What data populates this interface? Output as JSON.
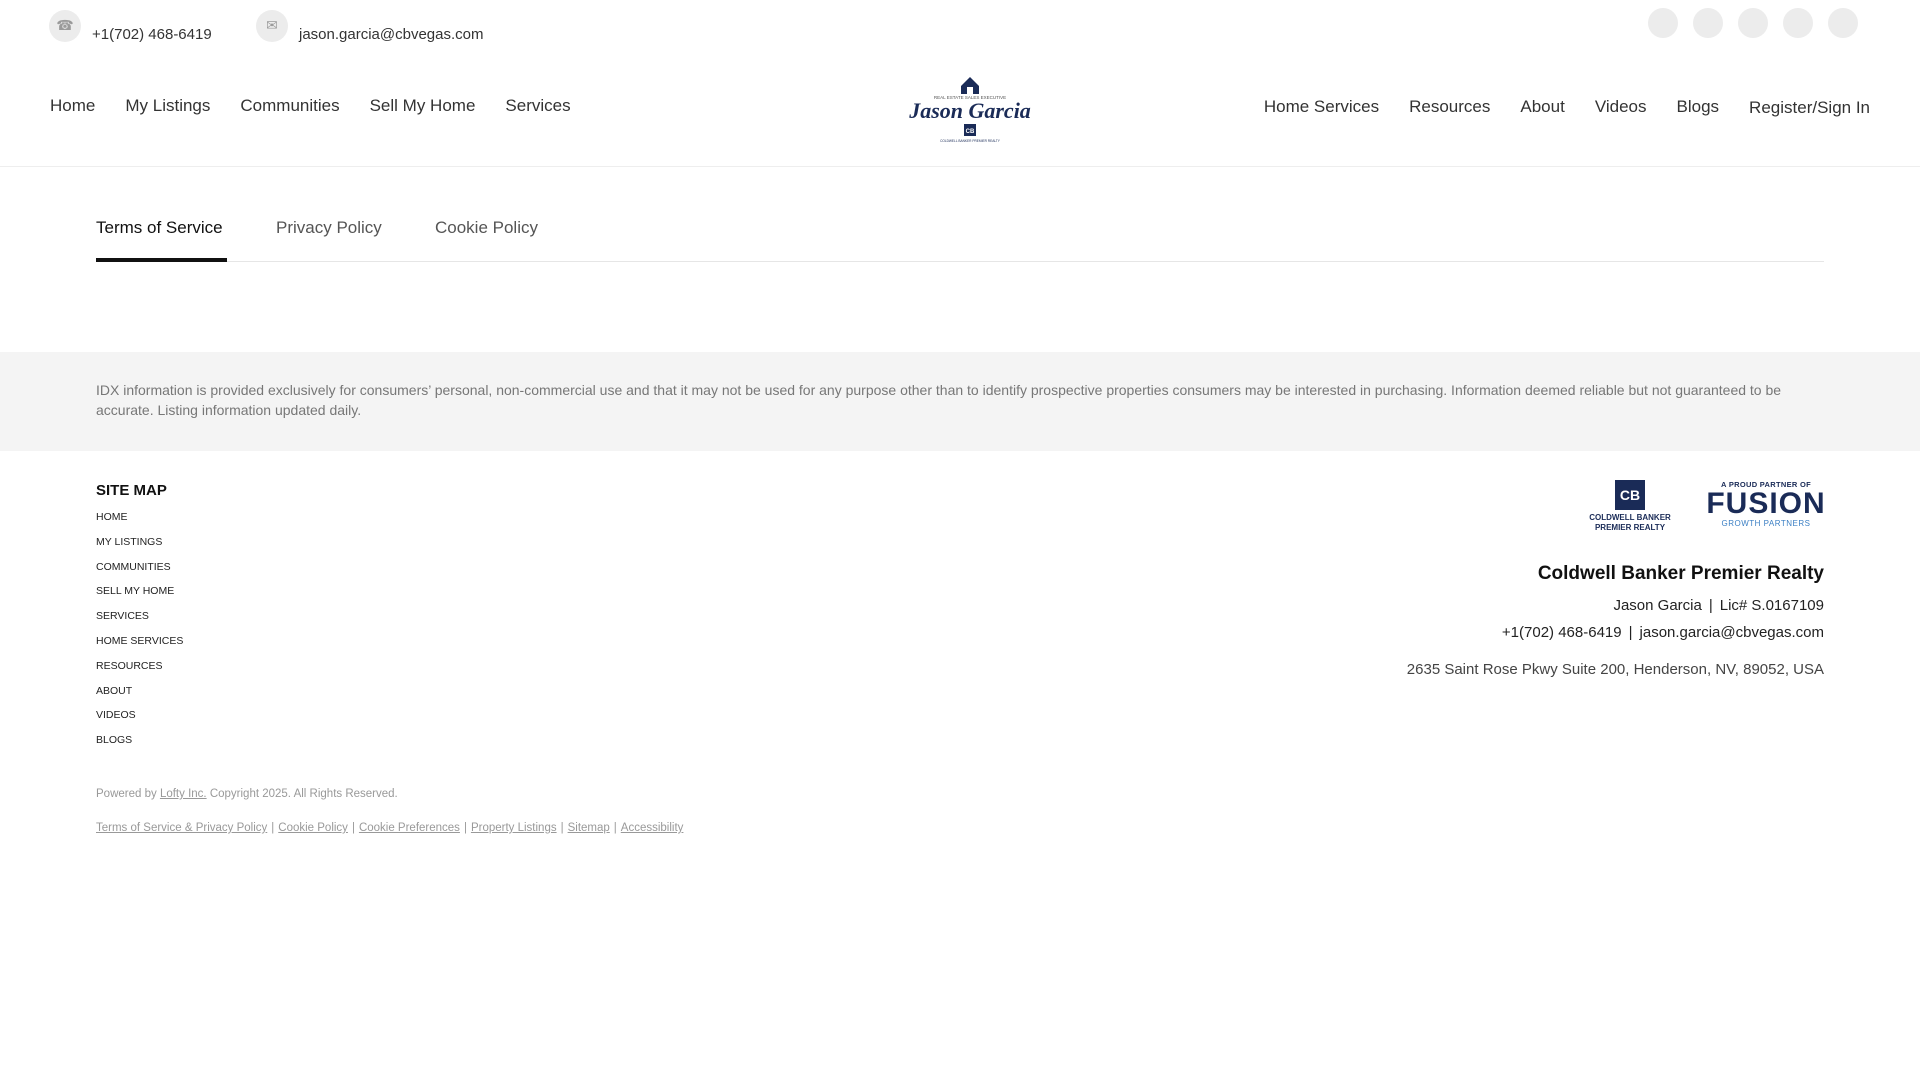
{
  "topbar": {
    "phone": "+1(702) 468-6419",
    "email": "jason.garcia@cbvegas.com",
    "phone_icon": "phone-icon",
    "email_icon": "mail-icon",
    "social_icons": [
      "facebook-icon",
      "instagram-icon",
      "linkedin-icon",
      "youtube-icon",
      "twitter-icon"
    ]
  },
  "nav": {
    "left": [
      "Home",
      "My Listings",
      "Communities",
      "Sell My Home",
      "Services"
    ],
    "right": [
      "Home Services",
      "Resources",
      "About",
      "Videos",
      "Blogs"
    ],
    "signin": "Register/Sign In"
  },
  "logo": {
    "tagline": "REAL ESTATE SALES EXECUTIVE",
    "name": "Jason Garcia",
    "sub": "COLDWELL BANKER PREMIER REALTY"
  },
  "tabs": {
    "items": [
      "Terms of Service",
      "Privacy Policy",
      "Cookie Policy"
    ],
    "active": "Terms of Service"
  },
  "idx_disclaimer": "IDX information is provided exclusively for consumers’ personal, non-commercial use and that it may not be used for any purpose other than to identify prospective properties consumers may be interested in purchasing. Information deemed reliable but not guaranteed to be accurate. Listing information updated daily.",
  "footer": {
    "sitemap_title": "SITE MAP",
    "sitemap": [
      "HOME",
      "MY LISTINGS",
      "COMMUNITIES",
      "SELL MY HOME",
      "SERVICES",
      "HOME SERVICES",
      "RESOURCES",
      "ABOUT",
      "VIDEOS",
      "BLOGS"
    ],
    "cb_logo": {
      "mark": "CB",
      "line1": "COLDWELL BANKER",
      "line2": "PREMIER REALTY"
    },
    "fusion_logo": {
      "top": "A PROUD PARTNER OF",
      "mid": "FUSION",
      "bottom": "GROWTH PARTNERS"
    },
    "company": "Coldwell Banker Premier Realty",
    "agent": "Jason Garcia",
    "license": "Lic# S.0167109",
    "separator": "|",
    "phone": "+1(702) 468-6419",
    "email": "jason.garcia@cbvegas.com",
    "address": "2635 Saint Rose Pkwy Suite 200, Henderson, NV, 89052, USA",
    "powered_prefix": "Powered by",
    "powered_link": "Lofty Inc.",
    "copyright": "Copyright 2025. All Rights Reserved.",
    "legal_links": [
      "Terms of Service & Privacy Policy",
      "Cookie Policy",
      "Cookie Preferences",
      "Property Listings",
      "Sitemap",
      "Accessibility"
    ]
  },
  "colors": {
    "brand_navy": "#1a2b57",
    "fusion_blue": "#3b7fc4",
    "disclaimer_bg": "#f4f4f4"
  }
}
